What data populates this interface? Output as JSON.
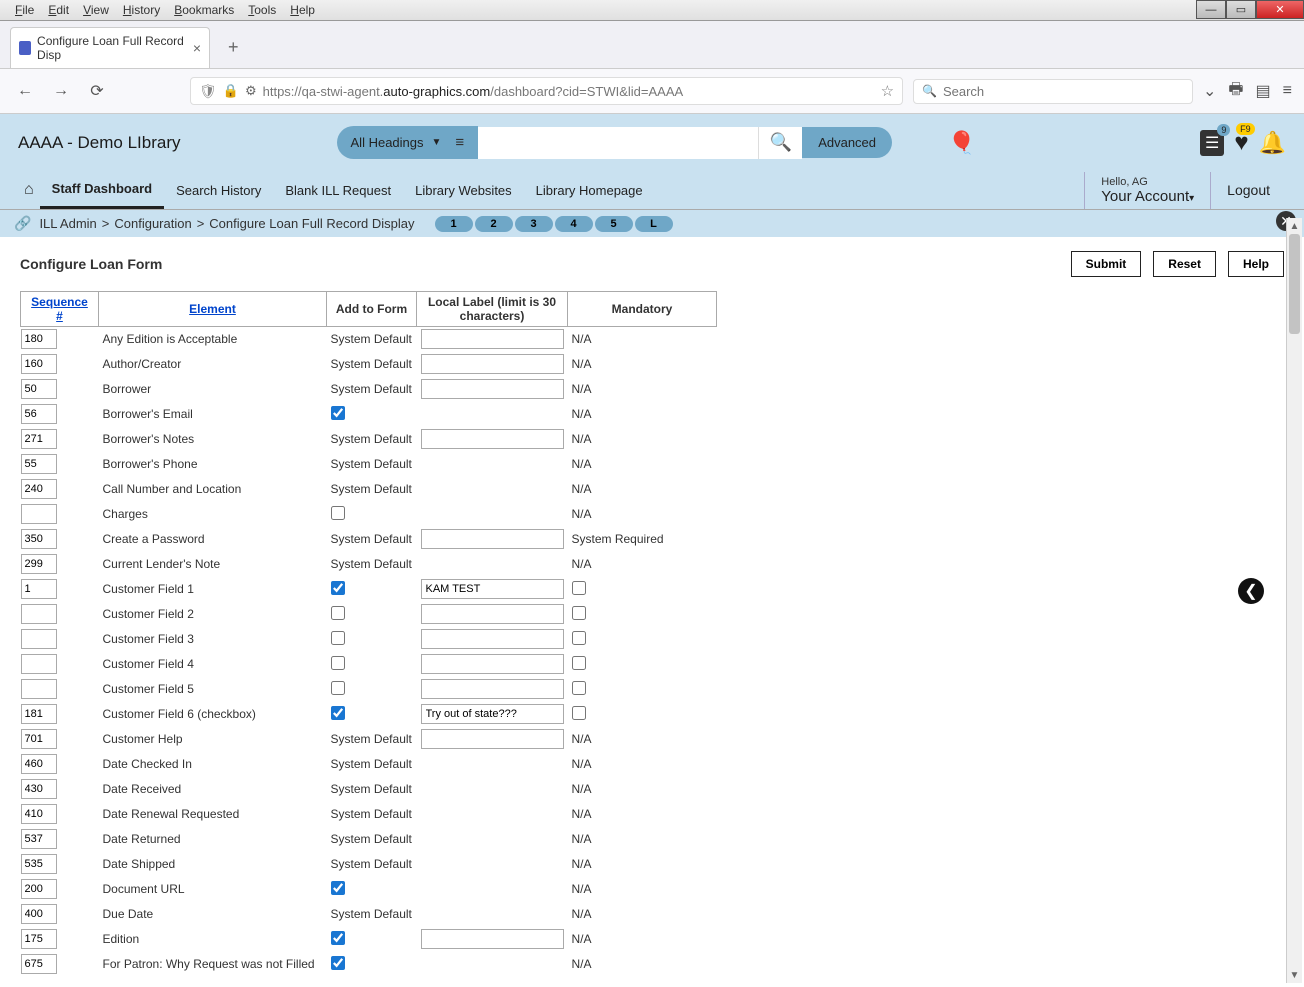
{
  "menubar": [
    "File",
    "Edit",
    "View",
    "History",
    "Bookmarks",
    "Tools",
    "Help"
  ],
  "tab": {
    "title": "Configure Loan Full Record Disp"
  },
  "url": {
    "pre": "https://qa-stwi-agent.",
    "host": "auto-graphics.com",
    "path": "/dashboard?cid=STWI&lid=AAAA"
  },
  "urlbar_search_placeholder": "Search",
  "library_name": "AAAA - Demo LIbrary",
  "headings_dd": "All Headings",
  "advanced": "Advanced",
  "badges": {
    "list": "9",
    "heart": "F9"
  },
  "nav": [
    "Staff Dashboard",
    "Search History",
    "Blank ILL Request",
    "Library Websites",
    "Library Homepage"
  ],
  "hello": "Hello, AG",
  "your_account": "Your Account",
  "logout": "Logout",
  "crumbs": [
    "ILL Admin",
    "Configuration",
    "Configure Loan Full Record Display"
  ],
  "page_pills": [
    "1",
    "2",
    "3",
    "4",
    "5",
    "L"
  ],
  "form_title": "Configure Loan Form",
  "buttons": {
    "submit": "Submit",
    "reset": "Reset",
    "help": "Help"
  },
  "columns": {
    "seq": "Sequence #",
    "elem": "Element",
    "add": "Add to Form",
    "label": "Local Label (limit is 30 characters)",
    "mand": "Mandatory"
  },
  "rows": [
    {
      "seq": "180",
      "elem": "Any Edition is Acceptable",
      "add": "System Default",
      "label": "",
      "mand": "N/A"
    },
    {
      "seq": "160",
      "elem": "Author/Creator",
      "add": "System Default",
      "label": "",
      "mand": "N/A"
    },
    {
      "seq": "50",
      "elem": "Borrower",
      "add": "System Default",
      "label": "",
      "mand": "N/A"
    },
    {
      "seq": "56",
      "elem": "Borrower's Email",
      "add": "check_true",
      "label": null,
      "mand": "N/A"
    },
    {
      "seq": "271",
      "elem": "Borrower's Notes",
      "add": "System Default",
      "label": "",
      "mand": "N/A"
    },
    {
      "seq": "55",
      "elem": "Borrower's Phone",
      "add": "System Default",
      "label": null,
      "mand": "N/A"
    },
    {
      "seq": "240",
      "elem": "Call Number and Location",
      "add": "System Default",
      "label": null,
      "mand": "N/A"
    },
    {
      "seq": "",
      "elem": "Charges",
      "add": "check_false",
      "label": null,
      "mand": "N/A"
    },
    {
      "seq": "350",
      "elem": "Create a Password",
      "add": "System Default",
      "label": "",
      "mand": "System Required"
    },
    {
      "seq": "299",
      "elem": "Current Lender's Note",
      "add": "System Default",
      "label": null,
      "mand": "N/A"
    },
    {
      "seq": "1",
      "elem": "Customer Field 1",
      "add": "check_true",
      "label": "KAM TEST",
      "mand": "check_false"
    },
    {
      "seq": "",
      "elem": "Customer Field 2",
      "add": "check_false",
      "label": "",
      "mand": "check_false"
    },
    {
      "seq": "",
      "elem": "Customer Field 3",
      "add": "check_false",
      "label": "",
      "mand": "check_false"
    },
    {
      "seq": "",
      "elem": "Customer Field 4",
      "add": "check_false",
      "label": "",
      "mand": "check_false"
    },
    {
      "seq": "",
      "elem": "Customer Field 5",
      "add": "check_false",
      "label": "",
      "mand": "check_false"
    },
    {
      "seq": "181",
      "elem": "Customer Field 6 (checkbox)",
      "add": "check_true",
      "label": "Try out of state???",
      "mand": "check_false"
    },
    {
      "seq": "701",
      "elem": "Customer Help",
      "add": "System Default",
      "label": "",
      "mand": "N/A"
    },
    {
      "seq": "460",
      "elem": "Date Checked In",
      "add": "System Default",
      "label": null,
      "mand": "N/A"
    },
    {
      "seq": "430",
      "elem": "Date Received",
      "add": "System Default",
      "label": null,
      "mand": "N/A"
    },
    {
      "seq": "410",
      "elem": "Date Renewal Requested",
      "add": "System Default",
      "label": null,
      "mand": "N/A"
    },
    {
      "seq": "537",
      "elem": "Date Returned",
      "add": "System Default",
      "label": null,
      "mand": "N/A"
    },
    {
      "seq": "535",
      "elem": "Date Shipped",
      "add": "System Default",
      "label": null,
      "mand": "N/A"
    },
    {
      "seq": "200",
      "elem": "Document URL",
      "add": "check_true",
      "label": null,
      "mand": "N/A"
    },
    {
      "seq": "400",
      "elem": "Due Date",
      "add": "System Default",
      "label": null,
      "mand": "N/A"
    },
    {
      "seq": "175",
      "elem": "Edition",
      "add": "check_true",
      "label": "",
      "mand": "N/A"
    },
    {
      "seq": "675",
      "elem": "For Patron: Why Request was not Filled",
      "add": "check_true",
      "label": null,
      "mand": "N/A"
    }
  ]
}
